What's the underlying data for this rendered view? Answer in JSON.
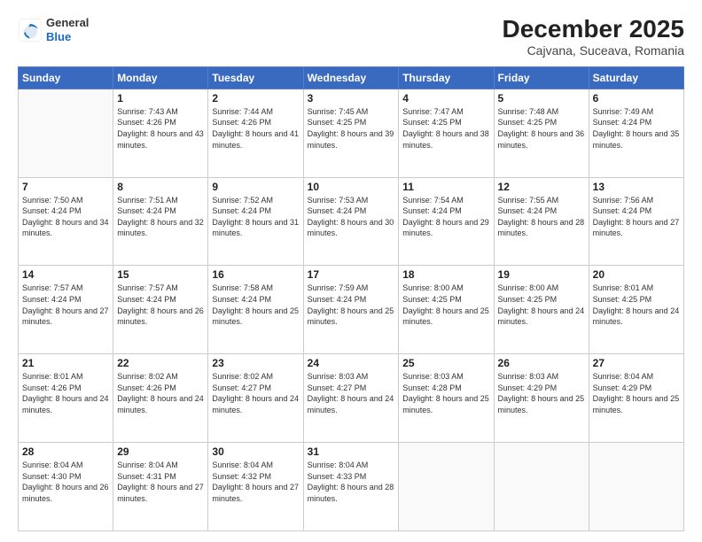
{
  "logo": {
    "general": "General",
    "blue": "Blue"
  },
  "title": "December 2025",
  "subtitle": "Cajvana, Suceava, Romania",
  "weekdays": [
    "Sunday",
    "Monday",
    "Tuesday",
    "Wednesday",
    "Thursday",
    "Friday",
    "Saturday"
  ],
  "weeks": [
    [
      {
        "day": "",
        "sunrise": "",
        "sunset": "",
        "daylight": ""
      },
      {
        "day": "1",
        "sunrise": "Sunrise: 7:43 AM",
        "sunset": "Sunset: 4:26 PM",
        "daylight": "Daylight: 8 hours and 43 minutes."
      },
      {
        "day": "2",
        "sunrise": "Sunrise: 7:44 AM",
        "sunset": "Sunset: 4:26 PM",
        "daylight": "Daylight: 8 hours and 41 minutes."
      },
      {
        "day": "3",
        "sunrise": "Sunrise: 7:45 AM",
        "sunset": "Sunset: 4:25 PM",
        "daylight": "Daylight: 8 hours and 39 minutes."
      },
      {
        "day": "4",
        "sunrise": "Sunrise: 7:47 AM",
        "sunset": "Sunset: 4:25 PM",
        "daylight": "Daylight: 8 hours and 38 minutes."
      },
      {
        "day": "5",
        "sunrise": "Sunrise: 7:48 AM",
        "sunset": "Sunset: 4:25 PM",
        "daylight": "Daylight: 8 hours and 36 minutes."
      },
      {
        "day": "6",
        "sunrise": "Sunrise: 7:49 AM",
        "sunset": "Sunset: 4:24 PM",
        "daylight": "Daylight: 8 hours and 35 minutes."
      }
    ],
    [
      {
        "day": "7",
        "sunrise": "Sunrise: 7:50 AM",
        "sunset": "Sunset: 4:24 PM",
        "daylight": "Daylight: 8 hours and 34 minutes."
      },
      {
        "day": "8",
        "sunrise": "Sunrise: 7:51 AM",
        "sunset": "Sunset: 4:24 PM",
        "daylight": "Daylight: 8 hours and 32 minutes."
      },
      {
        "day": "9",
        "sunrise": "Sunrise: 7:52 AM",
        "sunset": "Sunset: 4:24 PM",
        "daylight": "Daylight: 8 hours and 31 minutes."
      },
      {
        "day": "10",
        "sunrise": "Sunrise: 7:53 AM",
        "sunset": "Sunset: 4:24 PM",
        "daylight": "Daylight: 8 hours and 30 minutes."
      },
      {
        "day": "11",
        "sunrise": "Sunrise: 7:54 AM",
        "sunset": "Sunset: 4:24 PM",
        "daylight": "Daylight: 8 hours and 29 minutes."
      },
      {
        "day": "12",
        "sunrise": "Sunrise: 7:55 AM",
        "sunset": "Sunset: 4:24 PM",
        "daylight": "Daylight: 8 hours and 28 minutes."
      },
      {
        "day": "13",
        "sunrise": "Sunrise: 7:56 AM",
        "sunset": "Sunset: 4:24 PM",
        "daylight": "Daylight: 8 hours and 27 minutes."
      }
    ],
    [
      {
        "day": "14",
        "sunrise": "Sunrise: 7:57 AM",
        "sunset": "Sunset: 4:24 PM",
        "daylight": "Daylight: 8 hours and 27 minutes."
      },
      {
        "day": "15",
        "sunrise": "Sunrise: 7:57 AM",
        "sunset": "Sunset: 4:24 PM",
        "daylight": "Daylight: 8 hours and 26 minutes."
      },
      {
        "day": "16",
        "sunrise": "Sunrise: 7:58 AM",
        "sunset": "Sunset: 4:24 PM",
        "daylight": "Daylight: 8 hours and 25 minutes."
      },
      {
        "day": "17",
        "sunrise": "Sunrise: 7:59 AM",
        "sunset": "Sunset: 4:24 PM",
        "daylight": "Daylight: 8 hours and 25 minutes."
      },
      {
        "day": "18",
        "sunrise": "Sunrise: 8:00 AM",
        "sunset": "Sunset: 4:25 PM",
        "daylight": "Daylight: 8 hours and 25 minutes."
      },
      {
        "day": "19",
        "sunrise": "Sunrise: 8:00 AM",
        "sunset": "Sunset: 4:25 PM",
        "daylight": "Daylight: 8 hours and 24 minutes."
      },
      {
        "day": "20",
        "sunrise": "Sunrise: 8:01 AM",
        "sunset": "Sunset: 4:25 PM",
        "daylight": "Daylight: 8 hours and 24 minutes."
      }
    ],
    [
      {
        "day": "21",
        "sunrise": "Sunrise: 8:01 AM",
        "sunset": "Sunset: 4:26 PM",
        "daylight": "Daylight: 8 hours and 24 minutes."
      },
      {
        "day": "22",
        "sunrise": "Sunrise: 8:02 AM",
        "sunset": "Sunset: 4:26 PM",
        "daylight": "Daylight: 8 hours and 24 minutes."
      },
      {
        "day": "23",
        "sunrise": "Sunrise: 8:02 AM",
        "sunset": "Sunset: 4:27 PM",
        "daylight": "Daylight: 8 hours and 24 minutes."
      },
      {
        "day": "24",
        "sunrise": "Sunrise: 8:03 AM",
        "sunset": "Sunset: 4:27 PM",
        "daylight": "Daylight: 8 hours and 24 minutes."
      },
      {
        "day": "25",
        "sunrise": "Sunrise: 8:03 AM",
        "sunset": "Sunset: 4:28 PM",
        "daylight": "Daylight: 8 hours and 25 minutes."
      },
      {
        "day": "26",
        "sunrise": "Sunrise: 8:03 AM",
        "sunset": "Sunset: 4:29 PM",
        "daylight": "Daylight: 8 hours and 25 minutes."
      },
      {
        "day": "27",
        "sunrise": "Sunrise: 8:04 AM",
        "sunset": "Sunset: 4:29 PM",
        "daylight": "Daylight: 8 hours and 25 minutes."
      }
    ],
    [
      {
        "day": "28",
        "sunrise": "Sunrise: 8:04 AM",
        "sunset": "Sunset: 4:30 PM",
        "daylight": "Daylight: 8 hours and 26 minutes."
      },
      {
        "day": "29",
        "sunrise": "Sunrise: 8:04 AM",
        "sunset": "Sunset: 4:31 PM",
        "daylight": "Daylight: 8 hours and 27 minutes."
      },
      {
        "day": "30",
        "sunrise": "Sunrise: 8:04 AM",
        "sunset": "Sunset: 4:32 PM",
        "daylight": "Daylight: 8 hours and 27 minutes."
      },
      {
        "day": "31",
        "sunrise": "Sunrise: 8:04 AM",
        "sunset": "Sunset: 4:33 PM",
        "daylight": "Daylight: 8 hours and 28 minutes."
      },
      {
        "day": "",
        "sunrise": "",
        "sunset": "",
        "daylight": ""
      },
      {
        "day": "",
        "sunrise": "",
        "sunset": "",
        "daylight": ""
      },
      {
        "day": "",
        "sunrise": "",
        "sunset": "",
        "daylight": ""
      }
    ]
  ]
}
